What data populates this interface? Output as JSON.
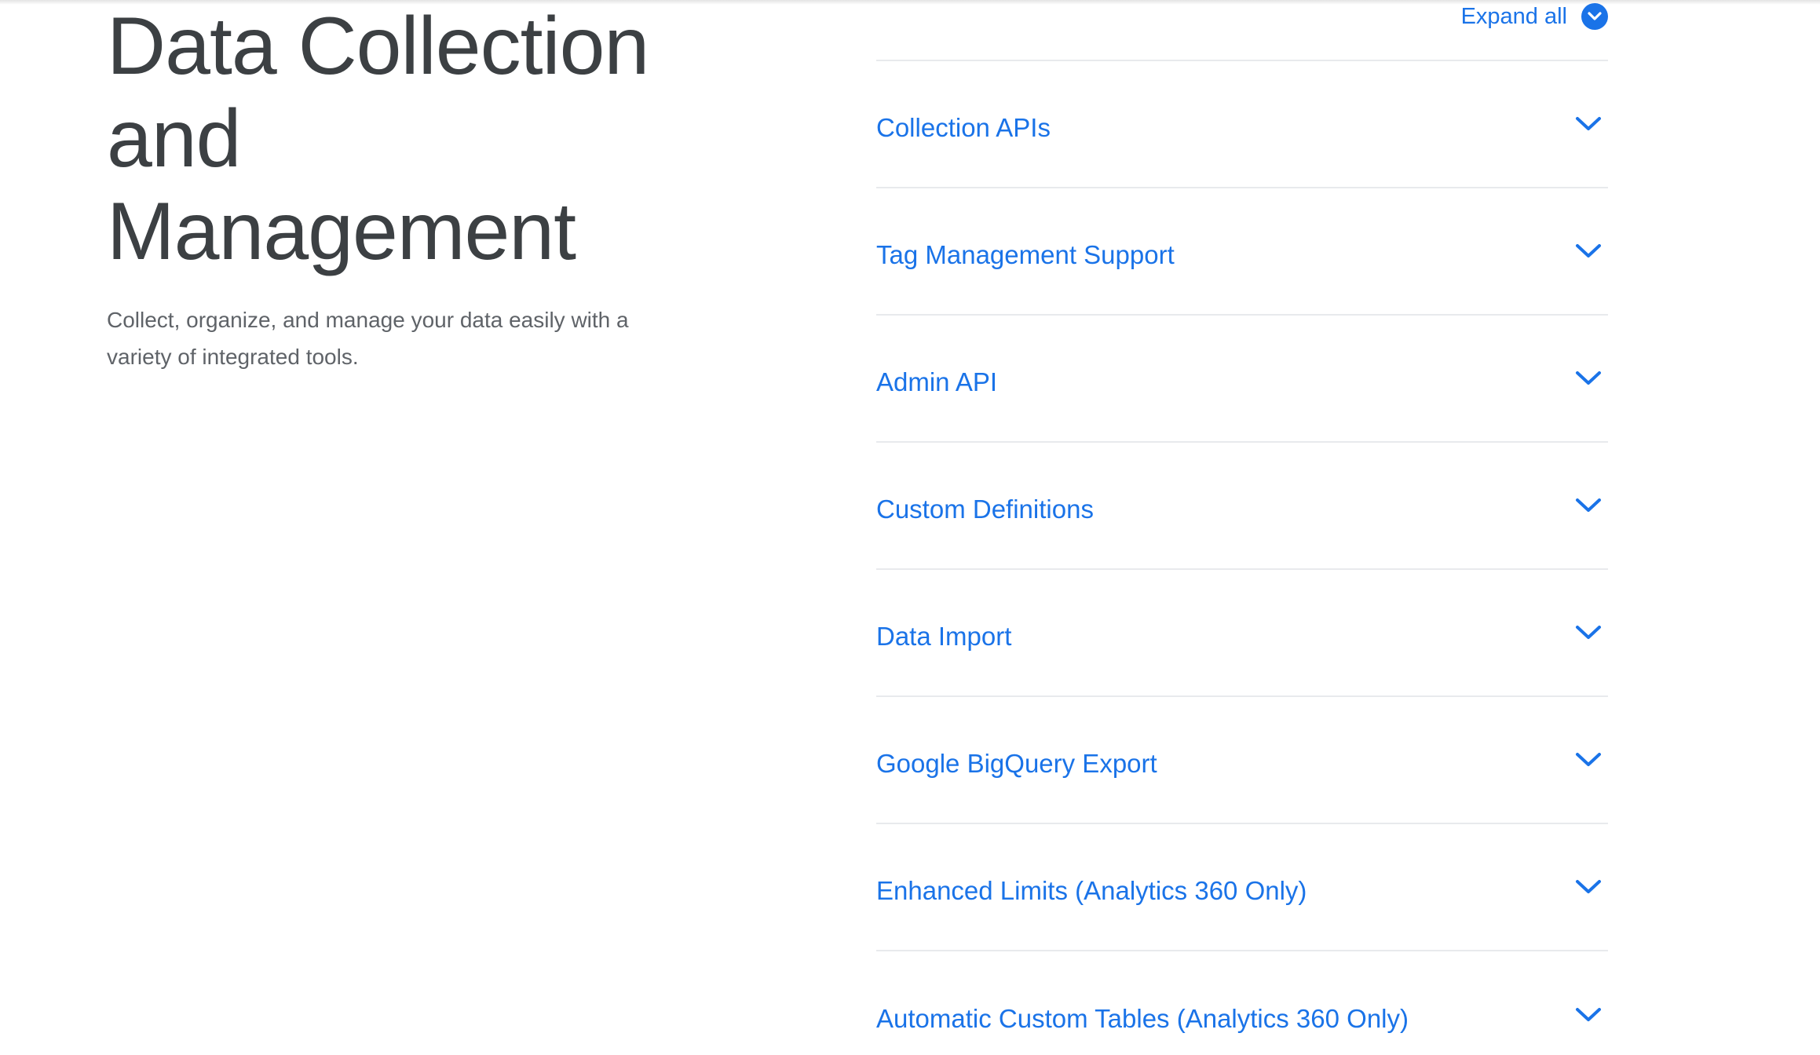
{
  "hero": {
    "title_line1": "Data Collection",
    "title_line2": "and",
    "title_line3": "Management",
    "description": "Collect, organize, and manage your data easily with a variety of integrated tools."
  },
  "accordion": {
    "expand_all_label": "Expand all",
    "expand_icon": "chevron-down-circle-icon",
    "item_icon": "chevron-down-icon",
    "accent_color": "#1a73e8",
    "items": [
      {
        "label": "Collection APIs"
      },
      {
        "label": "Tag Management Support"
      },
      {
        "label": "Admin API"
      },
      {
        "label": "Custom Definitions"
      },
      {
        "label": "Data Import"
      },
      {
        "label": "Google BigQuery Export"
      },
      {
        "label": "Enhanced Limits (Analytics 360 Only)"
      },
      {
        "label": "Automatic Custom Tables (Analytics 360 Only)"
      }
    ]
  }
}
